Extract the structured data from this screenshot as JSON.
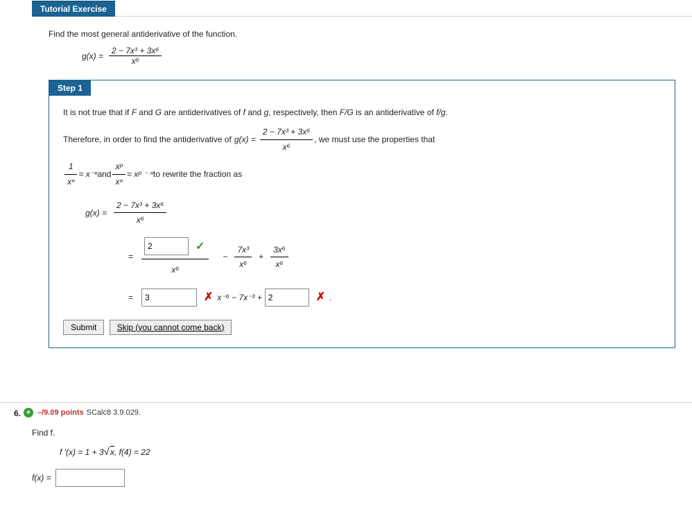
{
  "tutorial": {
    "header": "Tutorial Exercise",
    "prompt": "Find the most general antiderivative of the function.",
    "gx_label": "g(x) =",
    "gx_num": "2 − 7x³ + 3x⁶",
    "gx_den": "x⁶"
  },
  "step1": {
    "header": "Step 1",
    "line1a": "It is not true that if ",
    "F": "F",
    "and1": " and ",
    "G": "G",
    "line1b": " are antiderivatives of ",
    "f": "f",
    "and2": " and ",
    "g": "g",
    "line1c": ", respectively, then  ",
    "FG": "F/G",
    "line1d": "  is an antiderivative of  ",
    "fg": "f/g",
    "dot": ".",
    "line2a": "Therefore, in order to find the antiderivative of  ",
    "gx_eq": "g(x) =",
    "gx_num": "2 − 7x³ + 3x⁶",
    "gx_den": "x⁶",
    "line2b": ",  we must use the properties that",
    "rule1_num": "1",
    "rule1_den": "xⁿ",
    "rule1_eq": " = x⁻ⁿ",
    "and": "  and  ",
    "rule2_num": "xᵖ",
    "rule2_den": "xⁿ",
    "rule2_eq": " = xᵖ ⁻ ⁿ",
    "rewrite": "  to rewrite the fraction as",
    "gx2_label": "g(x)  =",
    "gx2_num": "2 − 7x³ + 3x⁶",
    "gx2_den": "x⁶",
    "row2_eq": "=",
    "row2_input": "2",
    "row2_den": "x⁶",
    "row2_mid1_num": "7x³",
    "row2_mid1_den": "x⁶",
    "row2_mid2_num": "3x⁶",
    "row2_mid2_den": "x⁶",
    "minus": "−",
    "plus": "+",
    "row3_eq": "=",
    "row3_input1": "3",
    "row3_text": "x⁻⁶ − 7x⁻³ +",
    "row3_input2": "2",
    "row3_dot": ".",
    "submit": "Submit",
    "skip": "Skip (you cannot come back)"
  },
  "q6": {
    "num": "6.",
    "points": "–/9.09 points",
    "ref": "SCalc8 3.9.029.",
    "prompt": "Find f.",
    "fprime": "f '(x) = 1 + 3",
    "sqrt_arg": "x",
    "cond": ",    f(4) = 22",
    "fx_label": "f(x)  ="
  }
}
